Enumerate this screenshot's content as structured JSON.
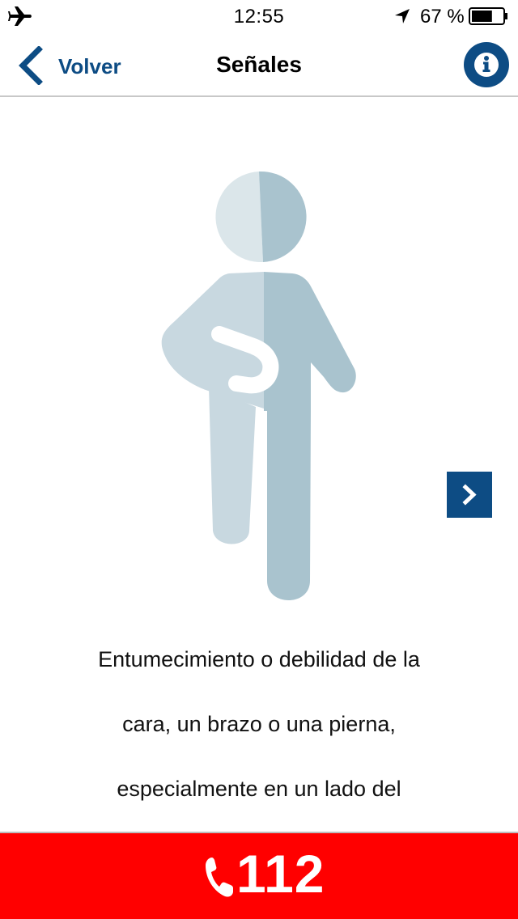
{
  "status_bar": {
    "time": "12:55",
    "battery_percent": "67 %",
    "battery_level": 0.67,
    "icons": [
      "airplane-mode-icon",
      "location-arrow-icon",
      "battery-icon"
    ]
  },
  "nav": {
    "back_label": "Volver",
    "title": "Señales",
    "info_icon": "info-icon",
    "accent_color": "#0d4c84"
  },
  "illustration": {
    "icon": "person-numbness-icon",
    "affected_side_color": "#c8d8e0",
    "unaffected_side_color": "#a9c3ce"
  },
  "pager": {
    "next_icon": "chevron-right-icon"
  },
  "description": {
    "lines": [
      "Entumecimiento o debilidad de la",
      "cara, un brazo o una pierna,",
      "especialmente en un lado del"
    ]
  },
  "emergency": {
    "number": "112",
    "icon": "phone-icon",
    "background_color": "#ff0000"
  }
}
